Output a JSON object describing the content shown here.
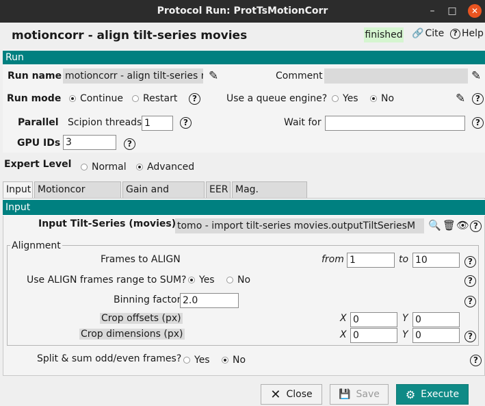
{
  "window": {
    "title": "Protocol Run: ProtTsMotionCorr"
  },
  "header": {
    "title": "motioncorr - align tilt-series movies",
    "status": "finished",
    "cite": "Cite",
    "help": "Help"
  },
  "run": {
    "section": "Run",
    "run_name_label": "Run name",
    "run_name_value": "motioncorr - align tilt-series mo",
    "comment_label": "Comment",
    "comment_value": "",
    "run_mode_label": "Run mode",
    "run_mode_options": [
      "Continue",
      "Restart"
    ],
    "run_mode_selected": "Continue",
    "queue_label": "Use a queue engine?",
    "queue_options": [
      "Yes",
      "No"
    ],
    "queue_selected": "No",
    "parallel_label": "Parallel",
    "threads_label": "Scipion threads",
    "threads_value": "1",
    "wait_label": "Wait for",
    "wait_value": "",
    "gpu_label": "GPU IDs",
    "gpu_value": "3"
  },
  "expert": {
    "label": "Expert Level",
    "options": [
      "Normal",
      "Advanced"
    ],
    "selected": "Advanced"
  },
  "tabs": [
    "Input",
    "Motioncor params",
    "Gain and defects",
    "EER",
    "Mag. correction"
  ],
  "input": {
    "section": "Input",
    "tilt_label": "Input Tilt-Series (movies)",
    "tilt_value": "tomo - import tilt-series movies.outputTiltSeriesM"
  },
  "alignment": {
    "legend": "Alignment",
    "frames_label": "Frames to ALIGN",
    "from_label": "from",
    "from_value": "1",
    "to_label": "to",
    "to_value": "10",
    "sum_label": "Use ALIGN frames range to SUM?",
    "sum_options": [
      "Yes",
      "No"
    ],
    "sum_selected": "Yes",
    "binning_label": "Binning factor",
    "binning_value": "2.0",
    "crop_offsets_label": "Crop offsets (px)",
    "crop_offsets_x": "0",
    "crop_offsets_y": "0",
    "crop_dims_label": "Crop dimensions (px)",
    "crop_dims_x": "0",
    "crop_dims_y": "0",
    "x_label": "X",
    "y_label": "Y"
  },
  "split": {
    "label": "Split & sum odd/even frames?",
    "options": [
      "Yes",
      "No"
    ],
    "selected": "No"
  },
  "buttons": {
    "close": "Close",
    "save": "Save",
    "execute": "Execute"
  }
}
